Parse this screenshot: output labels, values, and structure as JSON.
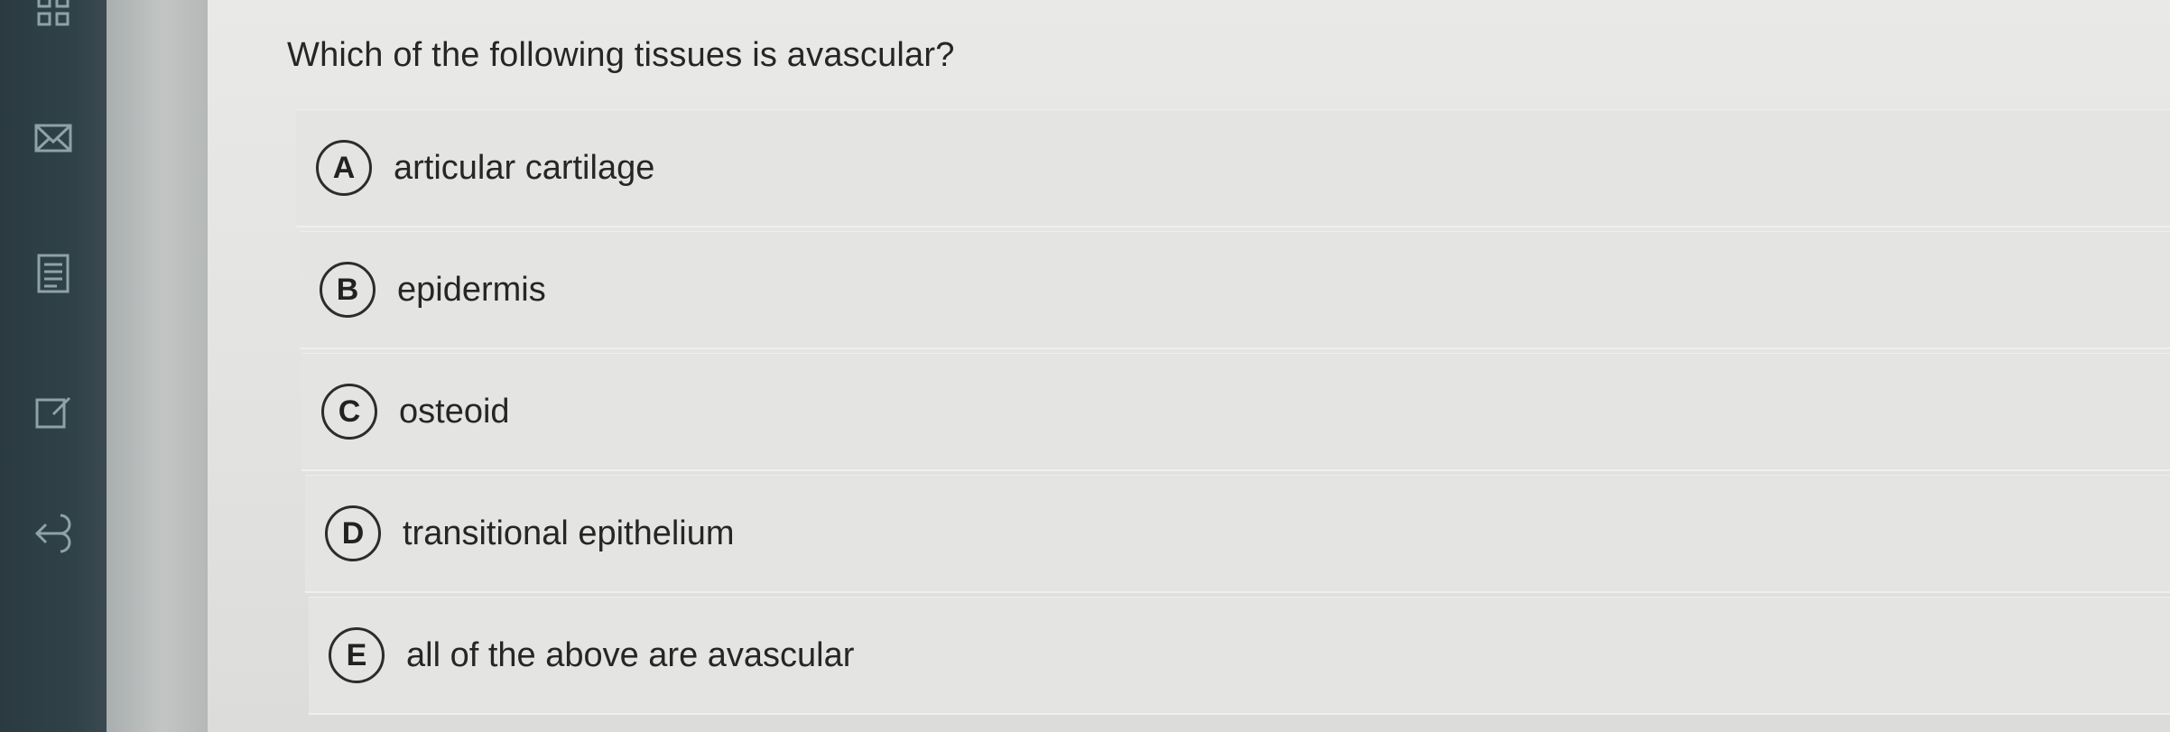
{
  "toolbar": {
    "tools": [
      {
        "icon": "grid-icon"
      },
      {
        "icon": "envelope-icon"
      },
      {
        "icon": "document-icon"
      },
      {
        "icon": "edit-icon"
      },
      {
        "icon": "back-arrow-icon"
      }
    ]
  },
  "question": {
    "text": "Which of the following tissues is avascular?"
  },
  "options": [
    {
      "letter": "A",
      "text": "articular cartilage"
    },
    {
      "letter": "B",
      "text": "epidermis"
    },
    {
      "letter": "C",
      "text": "osteoid"
    },
    {
      "letter": "D",
      "text": "transitional epithelium"
    },
    {
      "letter": "E",
      "text": "all of the above are avascular"
    }
  ],
  "colors": {
    "toolbar_bg": "#2f4147",
    "page_bg": "#e4e4e2",
    "text": "#262626"
  }
}
